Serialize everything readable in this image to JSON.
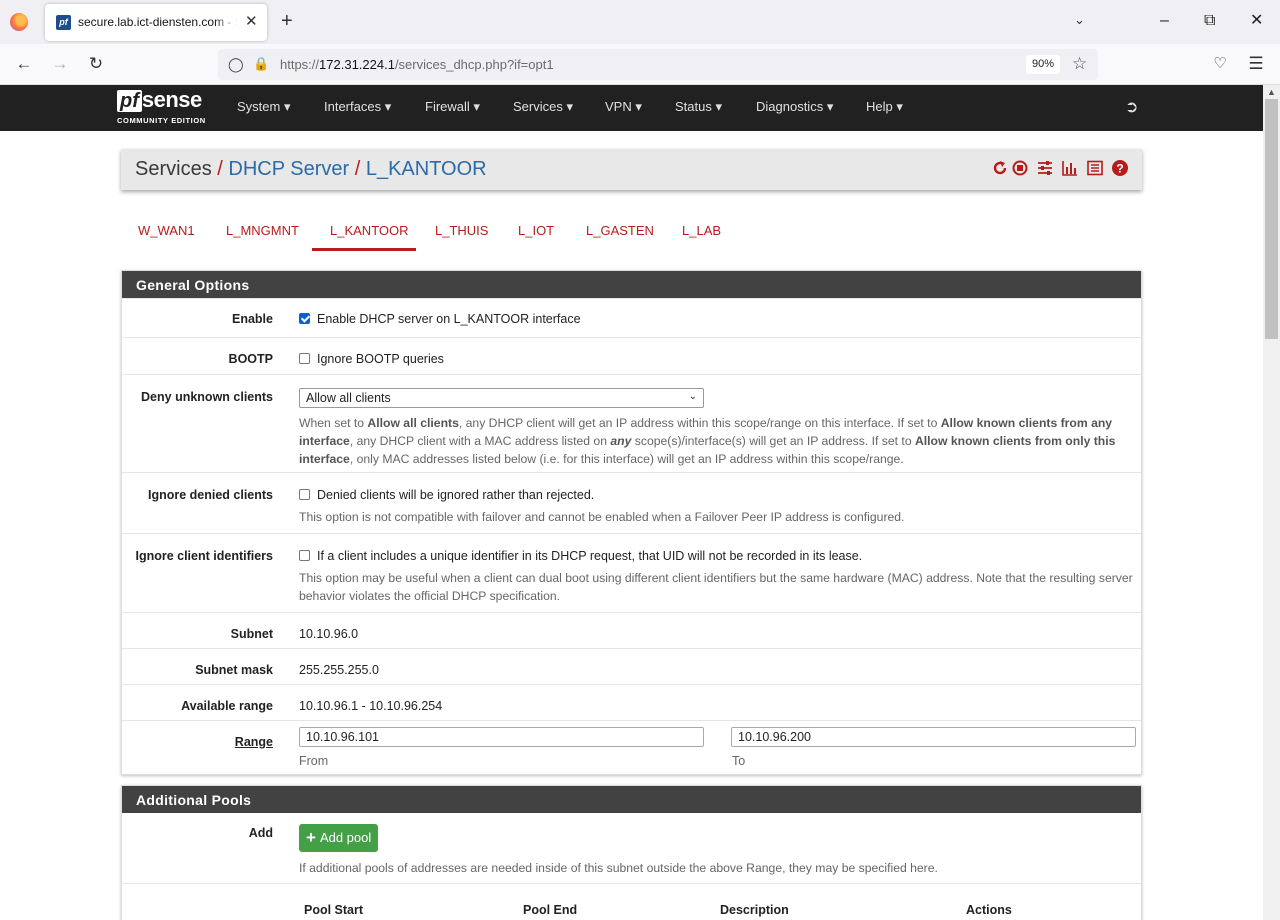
{
  "browser": {
    "tab_title": "secure.lab.ict-diensten.com - Services: DHCP Server: L_KANTOOR",
    "url_prefix": "https://",
    "url_host": "172.31.224.1",
    "url_path": "/services_dhcp.php?if=opt1",
    "zoom": "90%"
  },
  "pfsense": {
    "logo_pf": "pf",
    "logo_sense": "sense",
    "logo_edition": "COMMUNITY EDITION",
    "menu": [
      "System",
      "Interfaces",
      "Firewall",
      "Services",
      "VPN",
      "Status",
      "Diagnostics",
      "Help"
    ]
  },
  "breadcrumb": {
    "root": "Services",
    "section": "DHCP Server",
    "current": "L_KANTOOR"
  },
  "interface_tabs": [
    "W_WAN1",
    "L_MNGMNT",
    "L_KANTOOR",
    "L_THUIS",
    "L_IOT",
    "L_GASTEN",
    "L_LAB"
  ],
  "active_interface": "L_KANTOOR",
  "general": {
    "title": "General Options",
    "enable": {
      "label": "Enable",
      "text": "Enable DHCP server on L_KANTOOR interface",
      "checked": true
    },
    "bootp": {
      "label": "BOOTP",
      "text": "Ignore BOOTP queries",
      "checked": false
    },
    "deny": {
      "label": "Deny unknown clients",
      "selected": "Allow all clients",
      "help_1": "When set to ",
      "help_b1": "Allow all clients",
      "help_2": ", any DHCP client will get an IP address within this scope/range on this interface. If set to ",
      "help_b2": "Allow known clients from any interface",
      "help_3": ", any DHCP client with a MAC address listed on ",
      "help_b3": "any",
      "help_4": " scope(s)/interface(s) will get an IP address. If set to ",
      "help_b4": "Allow known clients from only this interface",
      "help_5": ", only MAC addresses listed below (i.e. for this interface) will get an IP address within this scope/range."
    },
    "ignore_denied": {
      "label": "Ignore denied clients",
      "text": "Denied clients will be ignored rather than rejected.",
      "help": "This option is not compatible with failover and cannot be enabled when a Failover Peer IP address is configured.",
      "checked": false
    },
    "ignore_uid": {
      "label": "Ignore client identifiers",
      "text": "If a client includes a unique identifier in its DHCP request, that UID will not be recorded in its lease.",
      "help": "This option may be useful when a client can dual boot using different client identifiers but the same hardware (MAC) address. Note that the resulting server behavior violates the official DHCP specification.",
      "checked": false
    },
    "subnet": {
      "label": "Subnet",
      "value": "10.10.96.0"
    },
    "mask": {
      "label": "Subnet mask",
      "value": "255.255.255.0"
    },
    "available": {
      "label": "Available range",
      "value": "10.10.96.1 - 10.10.96.254"
    },
    "range": {
      "label": "Range",
      "from": "10.10.96.101",
      "to": "10.10.96.200",
      "from_label": "From",
      "to_label": "To"
    }
  },
  "pools": {
    "title": "Additional Pools",
    "add_label": "Add",
    "add_button": "Add pool",
    "help": "If additional pools of addresses are needed inside of this subnet outside the above Range, they may be specified here.",
    "columns": [
      "Pool Start",
      "Pool End",
      "Description",
      "Actions"
    ]
  },
  "colors": {
    "accent": "#b71c1c",
    "link": "#2c6aa8",
    "panel_head": "#424242",
    "add_button": "#43a047",
    "header": "#212121"
  }
}
